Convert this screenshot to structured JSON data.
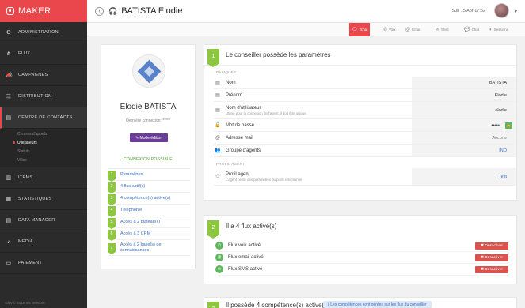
{
  "app": {
    "brand": "MAKER",
    "copyright": "vdev © 2018 Iris Telecom"
  },
  "sidebar": {
    "items": [
      {
        "label": "ADMINISTRATION",
        "icon": "gear-icon",
        "glyph": "⚙"
      },
      {
        "label": "FLUX",
        "icon": "sitemap-icon",
        "glyph": "⋔"
      },
      {
        "label": "CAMPAGNES",
        "icon": "megaphone-icon",
        "glyph": "📣"
      },
      {
        "label": "DISTRIBUTION",
        "icon": "distribution-icon",
        "glyph": "⇶"
      },
      {
        "label": "CENTRE DE CONTACTS",
        "icon": "contact-card-icon",
        "glyph": "▤"
      }
    ],
    "sub_items": [
      "Centres d'appels",
      "Utilisateurs",
      "Statuts",
      "Villes"
    ],
    "items_after": [
      {
        "label": "ITEMS",
        "icon": "database-icon",
        "glyph": "▥"
      },
      {
        "label": "STATISTIQUES",
        "icon": "chart-icon",
        "glyph": "▦"
      },
      {
        "label": "DATA MANAGER",
        "icon": "table-icon",
        "glyph": "▤"
      },
      {
        "label": "MÉDIA",
        "icon": "music-icon",
        "glyph": "♪"
      },
      {
        "label": "PAIEMENT",
        "icon": "credit-card-icon",
        "glyph": "▭"
      }
    ]
  },
  "header": {
    "back_glyph": "‹",
    "headset_glyph": "🎧",
    "title": "BATISTA Elodie",
    "date": "Sun 15 Apr 17:52",
    "caret": "▾"
  },
  "channels": [
    {
      "label": "Tchat",
      "icon": "chat-icon",
      "glyph": "🗨",
      "active": true
    },
    {
      "label": "Voix",
      "icon": "phone-icon",
      "glyph": "✆",
      "active": false
    },
    {
      "label": "Email",
      "icon": "email-icon",
      "glyph": "@",
      "active": false
    },
    {
      "label": "SMS",
      "icon": "sms-icon",
      "glyph": "✉",
      "active": false
    },
    {
      "label": "Chat",
      "icon": "chat-bubble-icon",
      "glyph": "💬",
      "active": false
    },
    {
      "label": "Sessions",
      "icon": "sessions-icon",
      "glyph": "◐",
      "active": false
    }
  ],
  "profile": {
    "name": "Elodie BATISTA",
    "last_connection": "Dernière connexion: *****",
    "edit_label": "✎ Mode édition",
    "connection_title": "CONNEXION POSSIBLE",
    "steps": [
      {
        "n": "1",
        "label": "Paramètres"
      },
      {
        "n": "2",
        "label": "4 flux actif(s)"
      },
      {
        "n": "3",
        "label": "4 compétence(s) active(s)"
      },
      {
        "n": "4",
        "label": "Téléphonie"
      },
      {
        "n": "5",
        "label": "Accès à 2 plateau(x)"
      },
      {
        "n": "6",
        "label": "Accès à 3 CRM"
      },
      {
        "n": "7",
        "label": "Accès à 2 base(s) de connaissances"
      }
    ]
  },
  "section1": {
    "num": "1",
    "title": "Le conseiller possède les paramètres",
    "group_basic": "BASIQUES",
    "rows": [
      {
        "icon": "id-card-icon",
        "glyph": "▤",
        "label": "Nom",
        "sub": "",
        "value": "BATISTA",
        "style": ""
      },
      {
        "icon": "id-card-icon",
        "glyph": "▤",
        "label": "Prénom",
        "sub": "",
        "value": "Elodie",
        "style": ""
      },
      {
        "icon": "id-card-icon",
        "glyph": "▤",
        "label": "Nom d'utilisateur",
        "sub": "Utilisé pour la connexion de l'agent, il doit être unique.",
        "value": "elodie",
        "style": ""
      },
      {
        "icon": "lock-icon",
        "glyph": "🔒",
        "label": "Mot de passe",
        "sub": "",
        "value": "••••••",
        "style": ""
      },
      {
        "icon": "at-icon",
        "glyph": "@",
        "label": "Adresse mail",
        "sub": "",
        "value": "Aucune",
        "style": "italic"
      },
      {
        "icon": "users-icon",
        "glyph": "👥",
        "label": "Groupe d'agents",
        "sub": "",
        "value": "INO",
        "style": "blue"
      }
    ],
    "group_profile": "PROFIL AGENT",
    "profile_row": {
      "icon": "user-settings-icon",
      "glyph": "⚇",
      "label": "Profil agent",
      "sub": "L'agent hérite des paramètres du profil sélectionné",
      "value": "Test"
    }
  },
  "section2": {
    "num": "2",
    "title": "Il a 4 flux activé(s)",
    "flux": [
      {
        "label": "Flux voix activé",
        "icon": "phone-icon",
        "glyph": "✆"
      },
      {
        "label": "Flux email activé",
        "icon": "email-icon",
        "glyph": "@"
      },
      {
        "label": "Flux SMS activé",
        "icon": "sms-icon",
        "glyph": "✉"
      }
    ],
    "deactivate_label": "✖ Désactiver"
  },
  "section3": {
    "num": "3",
    "title": "Il possède 4 compétence(s) active(s)",
    "info": "ℹ Les compétences sont gérées sur les flux du conseiller"
  }
}
